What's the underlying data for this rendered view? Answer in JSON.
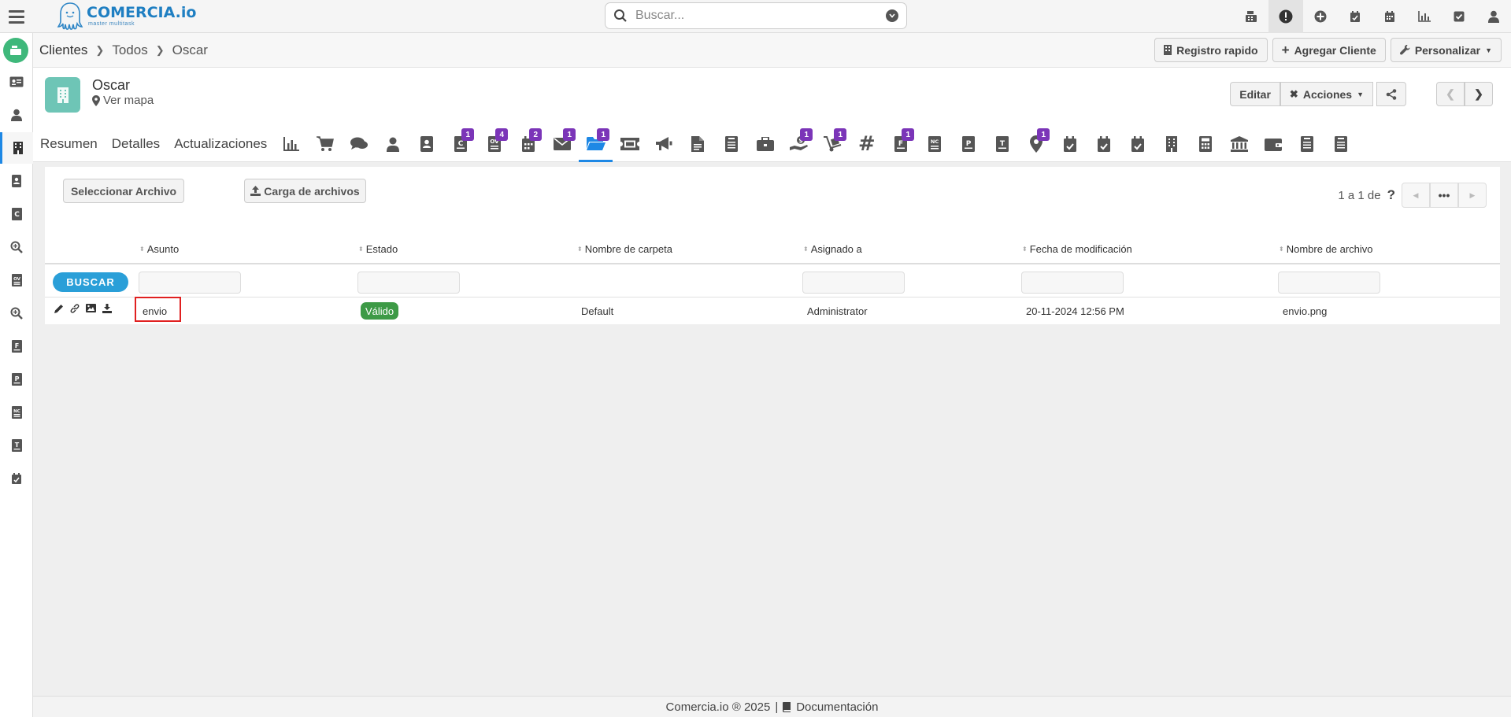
{
  "app": {
    "logo_title": "COMERCIA.io",
    "logo_subtitle": "master multitask",
    "search_placeholder": "Buscar..."
  },
  "top_icons": [
    "cash-register-icon",
    "alert-icon",
    "plus-circle-icon",
    "calendar-check-icon",
    "calendar-icon",
    "chart-icon",
    "check-square-icon",
    "user-icon"
  ],
  "breadcrumb": {
    "root": "Clientes",
    "middle": "Todos",
    "current": "Oscar"
  },
  "header_buttons": {
    "quick": "Registro rapido",
    "add": "Agregar Cliente",
    "customize": "Personalizar"
  },
  "record": {
    "name": "Oscar",
    "map_link": "Ver mapa",
    "edit": "Editar",
    "actions": "Acciones"
  },
  "tabs": {
    "text": [
      "Resumen",
      "Detalles",
      "Actualizaciones"
    ],
    "badges": {
      "t3": "1",
      "t4": "4",
      "t5": "2",
      "t6": "1",
      "t7": "1",
      "t15": "1",
      "t16": "1",
      "t18": "1",
      "t22": "1"
    }
  },
  "toolbar": {
    "select_file": "Seleccionar Archivo",
    "upload": "Carga de archivos"
  },
  "pager": {
    "text": "1 a 1  de"
  },
  "table": {
    "headers": [
      "Asunto",
      "Estado",
      "Nombre de carpeta",
      "Asignado a",
      "Fecha de modificación",
      "Nombre de archivo"
    ],
    "search_label": "BUSCAR",
    "row": {
      "subject": "envio",
      "status": "Válido",
      "folder": "Default",
      "assigned": "Administrator",
      "modified": "20-11-2024 12:56 PM",
      "filename": "envio.png"
    }
  },
  "footer": {
    "copyright": "Comercia.io ® 2025",
    "separator": "|",
    "docs": "Documentación"
  },
  "colors": {
    "accent": "#1e88e5",
    "badge": "#7b35b8",
    "status_ok": "#3d9a46",
    "buscar": "#2a9fd8",
    "highlight": "#e02020",
    "home": "#3fb87b"
  }
}
